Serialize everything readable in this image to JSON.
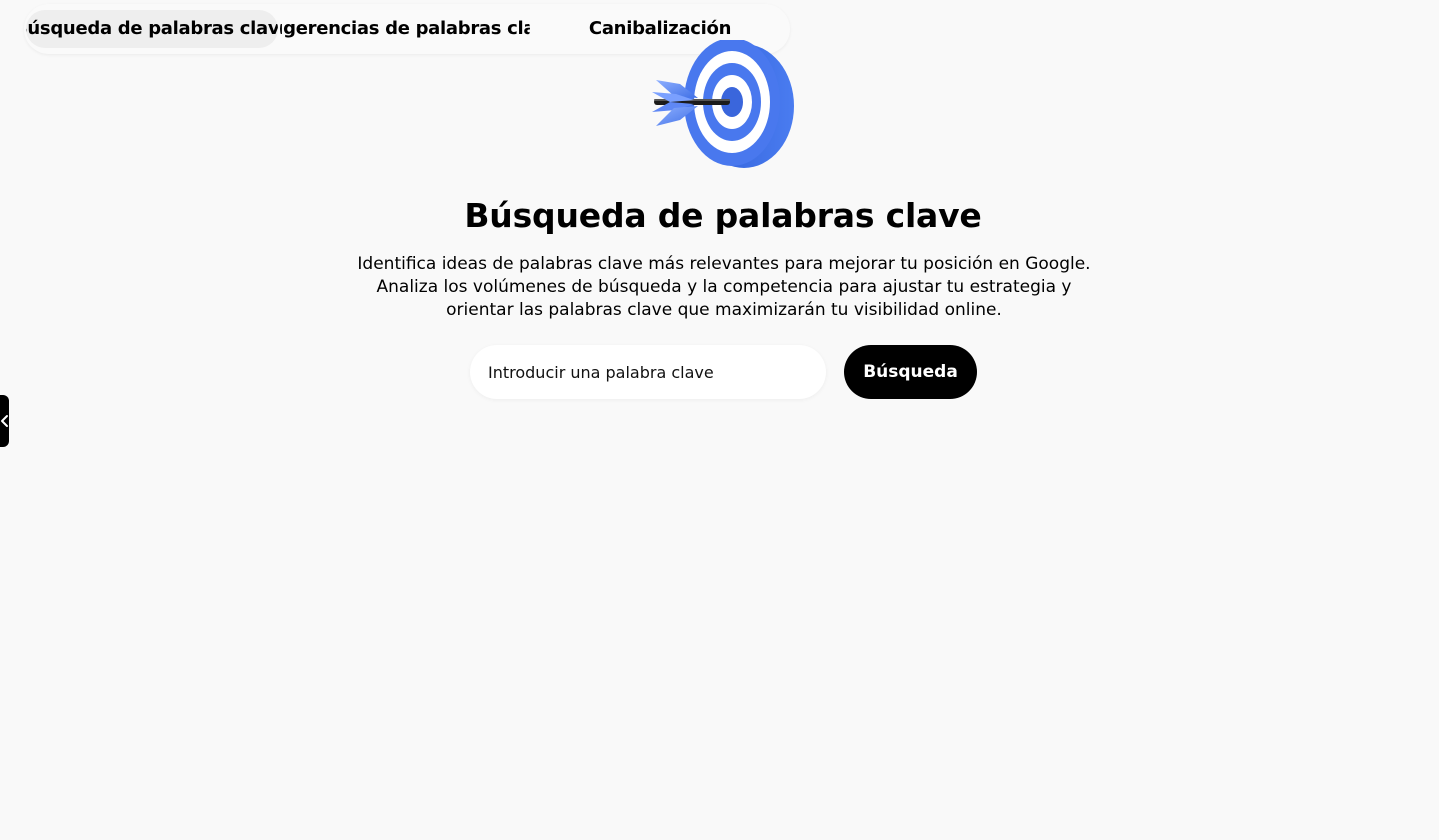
{
  "tabs": [
    {
      "label": "Búsqueda de palabras clave",
      "active": true
    },
    {
      "label": "Sugerencias de palabras clave",
      "active": false
    },
    {
      "label": "Canibalización",
      "active": false
    }
  ],
  "hero": {
    "icon": "target-arrow-icon",
    "title": "Búsqueda de palabras clave",
    "description_lines": [
      "Identifica ideas de palabras clave más relevantes para mejorar tu posición en Google.",
      "Analiza los volúmenes de búsqueda y la competencia para ajustar tu estrategia y",
      "orientar las palabras clave que maximizarán tu visibilidad online."
    ]
  },
  "search": {
    "placeholder": "Introducir una palabra clave",
    "value": "",
    "button_label": "Búsqueda"
  },
  "side_panel": {
    "icon": "chevron-left-icon"
  },
  "colors": {
    "background": "#f9f9f9",
    "target_blue": "#3f6fe6",
    "button_bg": "#000000",
    "active_tab_bg": "#eeeeee"
  }
}
